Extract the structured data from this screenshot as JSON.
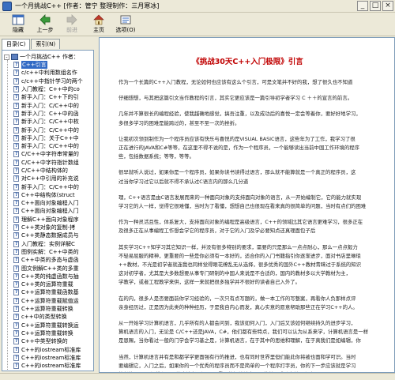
{
  "window": {
    "title": "一个月挑战C++ [作者：管宁 整理制作：三月寒冰]",
    "minimize_glyph": "_",
    "maximize_glyph": "□",
    "close_glyph": "×"
  },
  "toolbar": {
    "hide_label": "隐藏",
    "back_label": "上一步",
    "forward_label": "前进",
    "home_label": "主页",
    "options_label": "选项(O)"
  },
  "sidebar": {
    "tabs": [
      {
        "label": "目录(C)"
      },
      {
        "label": "索引(N)"
      }
    ],
    "root_label": "一个月挑战C++ 作者：",
    "root_toggle": "-",
    "items": [
      {
        "label": "C++引言"
      },
      {
        "label": "c/c++中利用数组名作"
      },
      {
        "label": "c/c++中指针学习的两个"
      },
      {
        "label": "入门教程：C++中的co"
      },
      {
        "label": "新手入门：C++下的引"
      },
      {
        "label": "新手入门：C/C++中的"
      },
      {
        "label": "新手入门：C++中的函"
      },
      {
        "label": "新手入门：C/C++中枚"
      },
      {
        "label": "新手入门：C/C++中的"
      },
      {
        "label": "新手入门：关于C++中"
      },
      {
        "label": "新手入门：C/C++中的"
      },
      {
        "label": "C/C++中字符串常量的"
      },
      {
        "label": "C/C++中字符指针数组"
      },
      {
        "label": "C/C++中结构体的"
      },
      {
        "label": "对C++中引用的补充说"
      },
      {
        "label": "新手入门：C/C++中的"
      },
      {
        "label": "C++中结构体(struct"
      },
      {
        "label": "C++面向对象编程入门"
      },
      {
        "label": "C++面向对象编程入门"
      },
      {
        "label": "理解C++面向对象程序"
      },
      {
        "label": "C++类对象的复制-拷"
      },
      {
        "label": "C++类静态数据成员与"
      },
      {
        "label": "入门教程：实例详解C"
      },
      {
        "label": "图例实解：C++中类的"
      },
      {
        "label": "C++中类的多态与虚函"
      },
      {
        "label": "图文例解C++类的多重"
      },
      {
        "label": "C++类的纯虚函数与抽"
      },
      {
        "label": "C++类的运算符重载"
      },
      {
        "label": "C++运算符重载函数基"
      },
      {
        "label": "C++运算符重载赋值运"
      },
      {
        "label": "C++运算符重载转换"
      },
      {
        "label": "c++中的类型转换"
      },
      {
        "label": "C++运算符重载转换运"
      },
      {
        "label": "C++运算符重载转换"
      },
      {
        "label": "C++中类型转换的"
      },
      {
        "label": "C++的iostream标准库"
      },
      {
        "label": "C++的iostream标准库"
      },
      {
        "label": "C++的iostream标准库"
      },
      {
        "label": "Eclipse3.06 + MinGW"
      }
    ]
  },
  "content": {
    "title": "《挑战30天C++入门极限》引言",
    "paragraphs": [
      "作为一个长篇的C++入门教程，无论如何也应该有这么个引言，可是文笔并不好的我，想了很久也不知道",
      "仔细想想，与其把这篇引文当作教程的引言，其实它更应该是一篇引导初学者学习 C ＋＋的宣言的前言。",
      "几年并不算很长的编程经验，使我越确地感觉，搞吾注重，以及成功后的喜悦一定会等着你，要好好地学习，",
      "多很多学习的困难是能跨过的，甚至不至一次的挫折。",
      "让我初次领到制作为一个程序员应该有快乐与喜悦的是VISUAL BASIC语言，这些年为了工作，我学习了很",
      "正在进行的JAVA和C#等等，在这里不得不说的是，作为一个程序员，一个能够读出当前中国工作环境的程序",
      "些，包括数据系统；等等，等等。",
      "很早就听人说过，如果你是一个程序员，如果你读书读得过语言，那么就不能算就是一个真正的程序员，这",
      "过当你学习过它以后就不得不承认过C语言内的那么几分道",
      "理，C++语言是由C语言发展而来的一种面向对象的支持面向对象的语言，从一开始编制它，它的能力就实现",
      "学习它的人一样，觉得它很难懂，当时为了看懂，想想自己也很现在看来真的很简单的问题，当时有点们的困难",
      "作为一种灵活且性，体系复大，支持面向对象的编程是高级语言，C++的领域比其它语言更难学习，很多正在",
      "及很多正在从事编程工作想会学它的程序员，对于它的入门及学必要知点还真理面包子后",
      "其实学习C++知学习其它知识一样，并没有很多特别的要求，需要的只是那么一点点耐心，那么一点点毅力",
      "不轻易屈服的精神，更重要的一些是你必须有一本好的，适合你的入门书籍指引你逐渐进步，面对书店里琳琅",
      "++教材，不光是初学者就连我也同样觉得眼花缭乱无从选择，很多优秀的国外C++教材青睐过于系统的知识",
      "这对初学者，尤其是大多数想要从事专门研制的中国人来说是不合适的，国内的教材多以大学教材为主，",
      "学教学，或者工程教学来供，这样一来就把很多独学并不很好的读者自己入外了。",
      "在的内，很多人是否要面前你学习经验的，一次只有点写题的，做一本工作的写整案，再看你人负那样点评",
      "亲身经历过，正是因为此类的种种经历，于是我自内心而发，真心实意的愿意帮助那些正在学习C++的人。",
      "从一开始学习计算机语言，几乎所有的人都会问到，我该如何入门，入门后又该如何继续持久的进步学习，",
      "算机语言的入门，无论是 C/C++还是JAVA，C#，他们都有些特点，我们可以认为从系来学，计算机语言是一样",
      "是恩赐，当你看过一般的门学会学习基之是，计算机语言，在于其中的思维和理解，在于真我们是如编辑，你",
      "当然，计算机语言并有是和都学学更面强有行的推进，也有同时世界里但们能此你将被也面和学可识。当时",
      "要编辑它，入门之后，如果你的一个优秀的程序员而不是简单的一个程序打字员，你的下一步应该就是学习",
      "的长篇C++入门教程正是编出读者入门C++重要的初始读本，目的就是成功在编写程序。"
    ]
  },
  "colors": {
    "title_red": "#c00000",
    "selected_bg": "#316ac5",
    "chrome_bg": "#ece9d8"
  },
  "icons": {
    "hide": "hide-panes-icon",
    "back": "back-arrow-icon",
    "forward": "forward-arrow-icon",
    "home": "home-icon",
    "options": "options-icon"
  }
}
